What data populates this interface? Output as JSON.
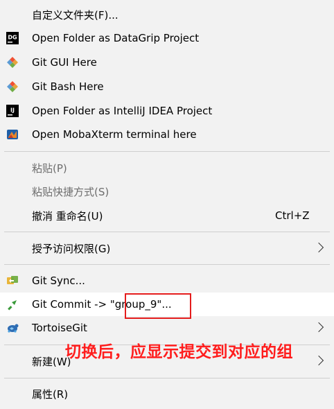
{
  "menu": {
    "custom_folder": "自定义文件夹(F)...",
    "datagrip": {
      "label": "Open Folder as DataGrip Project",
      "icon_text": "DG"
    },
    "git_gui": "Git GUI Here",
    "git_bash": "Git Bash Here",
    "intellij": {
      "label": "Open Folder as IntelliJ IDEA Project",
      "icon_text": "IJ"
    },
    "mobaxterm": "Open MobaXterm terminal here",
    "paste": "粘贴(P)",
    "paste_shortcut": "粘贴快捷方式(S)",
    "undo_rename": {
      "label": "撤消 重命名(U)",
      "shortcut": "Ctrl+Z"
    },
    "grant_access": "授予访问权限(G)",
    "git_sync": "Git Sync...",
    "git_commit": {
      "prefix": "Git Commit -> ",
      "branch": "\"group_9\"",
      "suffix": "..."
    },
    "tortoisegit": "TortoiseGit",
    "new": "新建(W)",
    "properties": "属性(R)"
  },
  "annotation": "切换后，应显示提交到对应的组",
  "colors": {
    "menu_bg": "#f2f2f2",
    "highlight_bg": "#ffffff",
    "disabled_text": "#6d6d6d",
    "annotation_red": "#ff1d1d",
    "separator": "#cfcfcf"
  }
}
